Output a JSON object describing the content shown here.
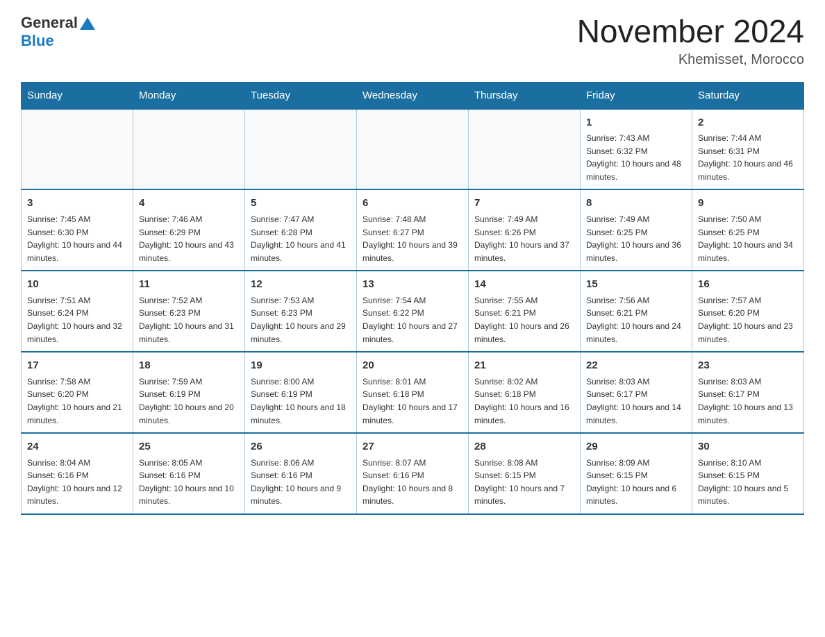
{
  "header": {
    "logo_general": "General",
    "logo_blue": "Blue",
    "month_title": "November 2024",
    "location": "Khemisset, Morocco"
  },
  "weekdays": [
    "Sunday",
    "Monday",
    "Tuesday",
    "Wednesday",
    "Thursday",
    "Friday",
    "Saturday"
  ],
  "weeks": [
    [
      {
        "day": "",
        "sunrise": "",
        "sunset": "",
        "daylight": ""
      },
      {
        "day": "",
        "sunrise": "",
        "sunset": "",
        "daylight": ""
      },
      {
        "day": "",
        "sunrise": "",
        "sunset": "",
        "daylight": ""
      },
      {
        "day": "",
        "sunrise": "",
        "sunset": "",
        "daylight": ""
      },
      {
        "day": "",
        "sunrise": "",
        "sunset": "",
        "daylight": ""
      },
      {
        "day": "1",
        "sunrise": "Sunrise: 7:43 AM",
        "sunset": "Sunset: 6:32 PM",
        "daylight": "Daylight: 10 hours and 48 minutes."
      },
      {
        "day": "2",
        "sunrise": "Sunrise: 7:44 AM",
        "sunset": "Sunset: 6:31 PM",
        "daylight": "Daylight: 10 hours and 46 minutes."
      }
    ],
    [
      {
        "day": "3",
        "sunrise": "Sunrise: 7:45 AM",
        "sunset": "Sunset: 6:30 PM",
        "daylight": "Daylight: 10 hours and 44 minutes."
      },
      {
        "day": "4",
        "sunrise": "Sunrise: 7:46 AM",
        "sunset": "Sunset: 6:29 PM",
        "daylight": "Daylight: 10 hours and 43 minutes."
      },
      {
        "day": "5",
        "sunrise": "Sunrise: 7:47 AM",
        "sunset": "Sunset: 6:28 PM",
        "daylight": "Daylight: 10 hours and 41 minutes."
      },
      {
        "day": "6",
        "sunrise": "Sunrise: 7:48 AM",
        "sunset": "Sunset: 6:27 PM",
        "daylight": "Daylight: 10 hours and 39 minutes."
      },
      {
        "day": "7",
        "sunrise": "Sunrise: 7:49 AM",
        "sunset": "Sunset: 6:26 PM",
        "daylight": "Daylight: 10 hours and 37 minutes."
      },
      {
        "day": "8",
        "sunrise": "Sunrise: 7:49 AM",
        "sunset": "Sunset: 6:25 PM",
        "daylight": "Daylight: 10 hours and 36 minutes."
      },
      {
        "day": "9",
        "sunrise": "Sunrise: 7:50 AM",
        "sunset": "Sunset: 6:25 PM",
        "daylight": "Daylight: 10 hours and 34 minutes."
      }
    ],
    [
      {
        "day": "10",
        "sunrise": "Sunrise: 7:51 AM",
        "sunset": "Sunset: 6:24 PM",
        "daylight": "Daylight: 10 hours and 32 minutes."
      },
      {
        "day": "11",
        "sunrise": "Sunrise: 7:52 AM",
        "sunset": "Sunset: 6:23 PM",
        "daylight": "Daylight: 10 hours and 31 minutes."
      },
      {
        "day": "12",
        "sunrise": "Sunrise: 7:53 AM",
        "sunset": "Sunset: 6:23 PM",
        "daylight": "Daylight: 10 hours and 29 minutes."
      },
      {
        "day": "13",
        "sunrise": "Sunrise: 7:54 AM",
        "sunset": "Sunset: 6:22 PM",
        "daylight": "Daylight: 10 hours and 27 minutes."
      },
      {
        "day": "14",
        "sunrise": "Sunrise: 7:55 AM",
        "sunset": "Sunset: 6:21 PM",
        "daylight": "Daylight: 10 hours and 26 minutes."
      },
      {
        "day": "15",
        "sunrise": "Sunrise: 7:56 AM",
        "sunset": "Sunset: 6:21 PM",
        "daylight": "Daylight: 10 hours and 24 minutes."
      },
      {
        "day": "16",
        "sunrise": "Sunrise: 7:57 AM",
        "sunset": "Sunset: 6:20 PM",
        "daylight": "Daylight: 10 hours and 23 minutes."
      }
    ],
    [
      {
        "day": "17",
        "sunrise": "Sunrise: 7:58 AM",
        "sunset": "Sunset: 6:20 PM",
        "daylight": "Daylight: 10 hours and 21 minutes."
      },
      {
        "day": "18",
        "sunrise": "Sunrise: 7:59 AM",
        "sunset": "Sunset: 6:19 PM",
        "daylight": "Daylight: 10 hours and 20 minutes."
      },
      {
        "day": "19",
        "sunrise": "Sunrise: 8:00 AM",
        "sunset": "Sunset: 6:19 PM",
        "daylight": "Daylight: 10 hours and 18 minutes."
      },
      {
        "day": "20",
        "sunrise": "Sunrise: 8:01 AM",
        "sunset": "Sunset: 6:18 PM",
        "daylight": "Daylight: 10 hours and 17 minutes."
      },
      {
        "day": "21",
        "sunrise": "Sunrise: 8:02 AM",
        "sunset": "Sunset: 6:18 PM",
        "daylight": "Daylight: 10 hours and 16 minutes."
      },
      {
        "day": "22",
        "sunrise": "Sunrise: 8:03 AM",
        "sunset": "Sunset: 6:17 PM",
        "daylight": "Daylight: 10 hours and 14 minutes."
      },
      {
        "day": "23",
        "sunrise": "Sunrise: 8:03 AM",
        "sunset": "Sunset: 6:17 PM",
        "daylight": "Daylight: 10 hours and 13 minutes."
      }
    ],
    [
      {
        "day": "24",
        "sunrise": "Sunrise: 8:04 AM",
        "sunset": "Sunset: 6:16 PM",
        "daylight": "Daylight: 10 hours and 12 minutes."
      },
      {
        "day": "25",
        "sunrise": "Sunrise: 8:05 AM",
        "sunset": "Sunset: 6:16 PM",
        "daylight": "Daylight: 10 hours and 10 minutes."
      },
      {
        "day": "26",
        "sunrise": "Sunrise: 8:06 AM",
        "sunset": "Sunset: 6:16 PM",
        "daylight": "Daylight: 10 hours and 9 minutes."
      },
      {
        "day": "27",
        "sunrise": "Sunrise: 8:07 AM",
        "sunset": "Sunset: 6:16 PM",
        "daylight": "Daylight: 10 hours and 8 minutes."
      },
      {
        "day": "28",
        "sunrise": "Sunrise: 8:08 AM",
        "sunset": "Sunset: 6:15 PM",
        "daylight": "Daylight: 10 hours and 7 minutes."
      },
      {
        "day": "29",
        "sunrise": "Sunrise: 8:09 AM",
        "sunset": "Sunset: 6:15 PM",
        "daylight": "Daylight: 10 hours and 6 minutes."
      },
      {
        "day": "30",
        "sunrise": "Sunrise: 8:10 AM",
        "sunset": "Sunset: 6:15 PM",
        "daylight": "Daylight: 10 hours and 5 minutes."
      }
    ]
  ]
}
